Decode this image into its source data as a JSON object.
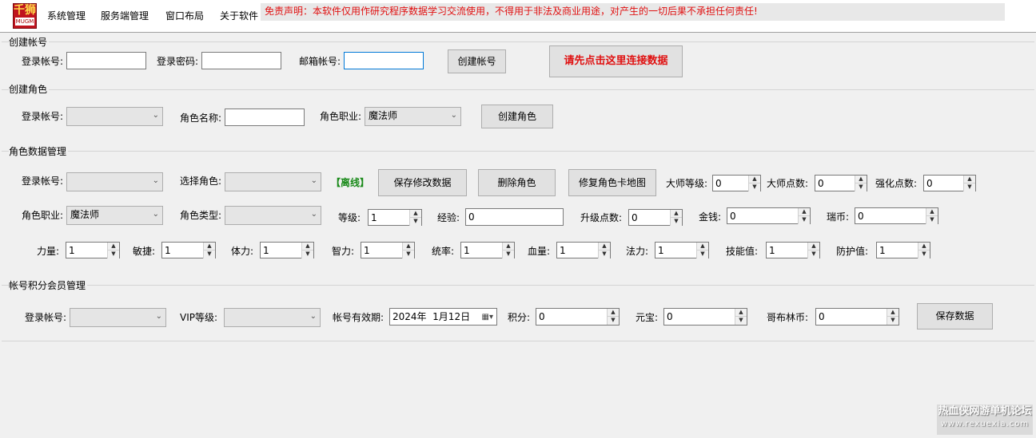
{
  "app": {
    "logo_top": "千狮",
    "logo_bottom": "MUGM",
    "menu": [
      "系统管理",
      "服务端管理",
      "窗口布局",
      "关于软件"
    ],
    "disclaimer": "免责声明：本软件仅用作研究程序数据学习交流使用，不得用于非法及商业用途，对产生的一切后果不承担任何责任!"
  },
  "create_account": {
    "title": "创建帐号",
    "login_label": "登录帐号:",
    "login_value": "",
    "password_label": "登录密码:",
    "password_value": "",
    "email_label": "邮箱帐号:",
    "email_value": "",
    "create_button": "创建帐号",
    "connect_button": "请先点击这里连接数据"
  },
  "create_role": {
    "title": "创建角色",
    "login_label": "登录帐号:",
    "login_value": "",
    "role_name_label": "角色名称:",
    "role_name_value": "",
    "job_label": "角色职业:",
    "job_value": "魔法师",
    "create_button": "创建角色"
  },
  "role_data": {
    "title": "角色数据管理",
    "login_label": "登录帐号:",
    "login_value": "",
    "select_role_label": "选择角色:",
    "select_role_value": "",
    "status": "【离线】",
    "save_button": "保存修改数据",
    "delete_button": "删除角色",
    "fix_map_button": "修复角色卡地图",
    "master_level_label": "大师等级:",
    "master_level": "0",
    "master_points_label": "大师点数:",
    "master_points": "0",
    "enhance_points_label": "强化点数:",
    "enhance_points": "0",
    "job_label": "角色职业:",
    "job_value": "魔法师",
    "role_type_label": "角色类型:",
    "role_type_value": "",
    "level_label": "等级:",
    "level": "1",
    "exp_label": "经验:",
    "exp": "0",
    "upgrade_points_label": "升级点数:",
    "upgrade_points": "0",
    "money_label": "金钱:",
    "money": "0",
    "ruby_label": "瑞币:",
    "ruby": "0",
    "stats": [
      {
        "label": "力量:",
        "value": "1"
      },
      {
        "label": "敏捷:",
        "value": "1"
      },
      {
        "label": "体力:",
        "value": "1"
      },
      {
        "label": "智力:",
        "value": "1"
      },
      {
        "label": "统率:",
        "value": "1"
      },
      {
        "label": "血量:",
        "value": "1"
      },
      {
        "label": "法力:",
        "value": "1"
      },
      {
        "label": "技能值:",
        "value": "1"
      },
      {
        "label": "防护值:",
        "value": "1"
      }
    ]
  },
  "vip": {
    "title": "帐号积分会员管理",
    "login_label": "登录帐号:",
    "login_value": "",
    "vip_label": "VIP等级:",
    "vip_value": "",
    "expiry_label": "帐号有效期:",
    "expiry_value": "2024年  1月12日",
    "points_label": "积分:",
    "points": "0",
    "yuanbao_label": "元宝:",
    "yuanbao": "0",
    "goblin_label": "哥布林币:",
    "goblin": "0",
    "save_button": "保存数据"
  },
  "watermark": {
    "line1": "热血侠网游单机论坛",
    "line2": "www.rexuexia.com"
  },
  "colors": {
    "disclaimer": "#e01010",
    "status_offline": "#1a8a1a",
    "background": "#f0f0f0"
  }
}
